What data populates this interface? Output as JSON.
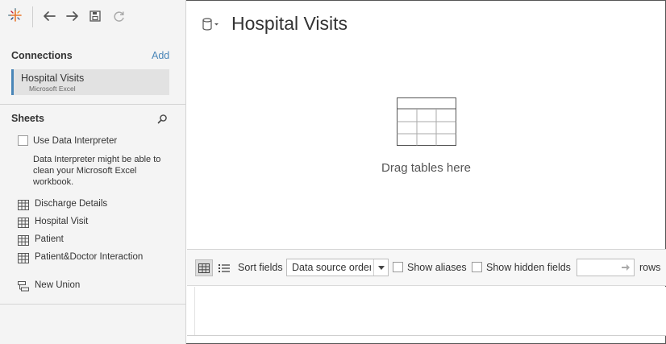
{
  "toolbar": {
    "logo_icon": "tableau-logo-icon",
    "back_icon": "arrow-left-icon",
    "forward_icon": "arrow-right-icon",
    "save_icon": "save-icon",
    "refresh_icon": "refresh-icon"
  },
  "connections": {
    "header": "Connections",
    "add_label": "Add",
    "items": [
      {
        "name": "Hospital Visits",
        "type": "Microsoft Excel"
      }
    ]
  },
  "sheets": {
    "header": "Sheets",
    "search_icon": "search-icon",
    "data_interpreter": {
      "label": "Use Data Interpreter",
      "checked": false,
      "description": "Data Interpreter might be able to clean your Microsoft Excel workbook."
    },
    "items": [
      {
        "label": "Discharge Details",
        "icon": "table-icon"
      },
      {
        "label": "Hospital Visit",
        "icon": "table-icon"
      },
      {
        "label": "Patient",
        "icon": "table-icon"
      },
      {
        "label": "Patient&Doctor Interaction",
        "icon": "table-icon"
      }
    ],
    "new_union": {
      "label": "New Union",
      "icon": "union-icon"
    }
  },
  "main": {
    "datasource_icon": "datasource-cylinder-icon",
    "title": "Hospital Visits",
    "drop_icon": "table-grid-icon",
    "drop_text": "Drag tables here"
  },
  "grid_toolbar": {
    "grid_view_icon": "grid-view-icon",
    "list_view_icon": "list-view-icon",
    "sort_label": "Sort fields",
    "sort_value": "Data source order",
    "show_aliases_label": "Show aliases",
    "show_aliases_checked": false,
    "show_hidden_label": "Show hidden fields",
    "show_hidden_checked": false,
    "rows_value": "",
    "rows_label": "rows"
  },
  "colors": {
    "accent": "#4a86b8",
    "panel_bg": "#f4f4f4",
    "text": "#333333"
  }
}
